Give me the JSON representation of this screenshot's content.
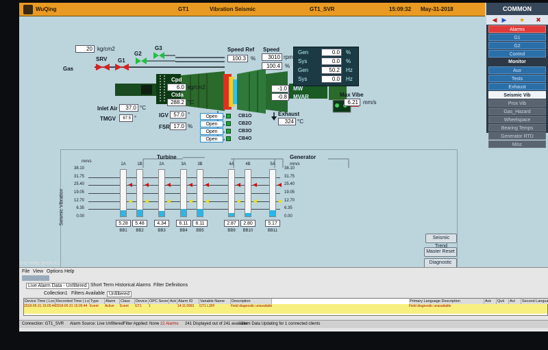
{
  "titlebar": {
    "site": "WuQing",
    "unit": "GT1",
    "screen": "Vibration Seismic",
    "server": "GT1_SVR",
    "time": "15:09:32",
    "date": "May-31-2018"
  },
  "menu": {
    "title": "COMMON",
    "items": [
      {
        "label": "Alarms",
        "style": "alarm"
      },
      {
        "label": "G1",
        "style": "normal"
      },
      {
        "label": "G2",
        "style": "normal"
      },
      {
        "label": "Control",
        "style": "normal"
      },
      {
        "label": "Monitor",
        "style": "head"
      },
      {
        "label": "Aux",
        "style": "normal"
      },
      {
        "label": "Tests",
        "style": "normal"
      },
      {
        "label": "Exhaust",
        "style": "normal"
      },
      {
        "label": "Seismic Vib",
        "style": "active"
      },
      {
        "label": "Prox Vib",
        "style": "dim"
      },
      {
        "label": "Gas_Hazard",
        "style": "dim"
      },
      {
        "label": "Wheelspace",
        "style": "dim"
      },
      {
        "label": "Bearing Temps",
        "style": "dim"
      },
      {
        "label": "Generator RTD",
        "style": "dim"
      },
      {
        "label": "Misc",
        "style": "dim"
      }
    ]
  },
  "process": {
    "gas_pressure": "20",
    "gas_pressure_unit": "kg/cm2",
    "gas_label": "Gas",
    "srv_label": "SRV",
    "g1_label": "G1",
    "g2_label": "G2",
    "g3_label": "G3",
    "speed_ref_label": "Speed Ref",
    "speed_ref": "100.3",
    "speed_ref_unit": "%",
    "speed_label": "Speed",
    "speed_rpm": "3010",
    "speed_rpm_unit": "rpm",
    "speed_pct": "100.4",
    "speed_pct_unit": "%",
    "cpd_label": "Cpd",
    "cpd": "6.0",
    "cpd_unit": "kg/cm2",
    "ctda_label": "Ctda",
    "ctda": "288.2",
    "ctda_unit": "°C",
    "inlet_air_label": "Inlet Air",
    "inlet_air": "37.0",
    "inlet_air_unit": "°C",
    "tmgv_label": "TMGV",
    "tmgv": "67.5",
    "tmgv_unit": "°",
    "igv_label": "IGV",
    "igv": "57.0",
    "igv_unit": "°",
    "fsr_label": "FSR",
    "fsr": "17.0",
    "fsr_unit": "%",
    "mw": "-1.0",
    "mw_unit": "MW",
    "mvar": "-0.8",
    "mvar_unit": "MVAR",
    "max_vibe_label": "Max Vibe",
    "max_vibe": "6.21",
    "max_vibe_unit": "mm/s",
    "exhaust_label": "Exhaust",
    "exhaust": "324",
    "exhaust_unit": "°C",
    "gen_panel": [
      {
        "label": "Gen",
        "value": "0.0",
        "unit": "%"
      },
      {
        "label": "Sys",
        "value": "0.0",
        "unit": "%"
      },
      {
        "label": "Gen",
        "value": "50.2",
        "unit": "Hz"
      },
      {
        "label": "Sys",
        "value": "0.0",
        "unit": "Hz"
      }
    ],
    "bleeds": [
      {
        "state": "Open",
        "name": "CB1O"
      },
      {
        "state": "Open",
        "name": "CB2O"
      },
      {
        "state": "Open",
        "name": "CB3O"
      },
      {
        "state": "Open",
        "name": "CB4O"
      }
    ]
  },
  "vibration": {
    "turbine_label": "Turbine",
    "generator_label": "Generator",
    "axis_label": "Seismic Vibration",
    "unit_left": "mm/s",
    "unit_right": "mm/s",
    "ticks": [
      "38.10",
      "31.75",
      "25.40",
      "19.05",
      "12.70",
      "6.35",
      "0.00"
    ],
    "bars": [
      {
        "top": "1A",
        "value": "5.28",
        "bottom": "BB1"
      },
      {
        "top": "1B",
        "value": "5.48",
        "bottom": "BB2"
      },
      {
        "top": "2A",
        "value": "4.34",
        "bottom": "BB3"
      },
      {
        "top": "3A",
        "value": "6.11",
        "bottom": "BB4"
      },
      {
        "top": "3B",
        "value": "6.11",
        "bottom": "BB5"
      },
      {
        "top": "4A",
        "value": "2.87",
        "bottom": "BB9"
      },
      {
        "top": "4B",
        "value": "2.80",
        "bottom": "BB10"
      },
      {
        "top": "5A",
        "value": "5.17",
        "bottom": "BB11"
      }
    ],
    "seismic_trend_button": "Seismic Trend",
    "master_reset_button": "Master Reset",
    "diag_reset_button": "Diagnostic Reset",
    "copyright_1": "2015 © General Electric Company",
    "copyright_2": "All rights reserved"
  },
  "alarm_viewer": {
    "help": "For Help, press F1",
    "menu_file": "File",
    "menu_view": "View",
    "menu_options": "Options",
    "menu_help": "Help",
    "tab_live": "Live Alarm Data - Unfiltered",
    "tab_short": "Short Term Historical Alarms",
    "tab_filter": "Filter Definitions",
    "collection": "Collection1",
    "filters_available": "Filters Available",
    "filter_value": "Unfiltered",
    "columns": [
      "Device Time | Local Time",
      "Recorded Time | Local Time",
      "Type",
      "Alarm",
      "Class",
      "Device",
      "OPC Severity",
      "Ack",
      "Alarm ID",
      "Variable Name",
      "Description",
      "Primary Language Description",
      "Ack",
      "Quit",
      "Act",
      "Second Language De"
    ],
    "row1": [
      "2018-05-31 15:05:44",
      "2018-05-31 15:05:44",
      "Event",
      "Active",
      "Event",
      "GT1",
      "1",
      "",
      "14:11:0981",
      "GT1 L30F",
      "Field diagnostic unavailable",
      "Field diagnostic unavailable"
    ],
    "status_connection": "Connection: GT1_SVR",
    "status_source": "Alarm Source: Live Unfiltered",
    "status_filter": "Filter Applied: None",
    "status_count": "22 Alarms",
    "status_displayed": "241 Displayed out of 241 available",
    "status_updating": "Alarm Data Updating for 1 connected clients"
  }
}
